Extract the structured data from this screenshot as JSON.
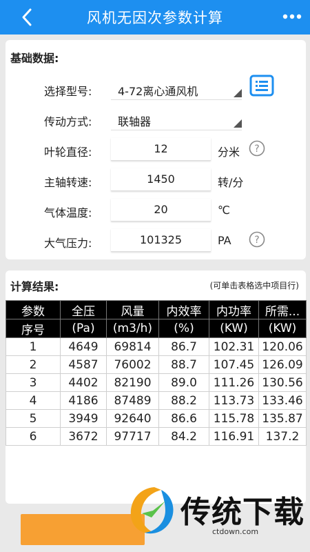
{
  "header": {
    "title": "风机无因次参数计算",
    "back_icon": "chevron-left-icon",
    "more_icon": "more-dots-icon",
    "color": "#1d8ff0"
  },
  "basic": {
    "section_title": "基础数据:",
    "model": {
      "label": "选择型号:",
      "value": "4-72离心通风机"
    },
    "drive": {
      "label": "传动方式:",
      "value": "联轴器"
    },
    "diameter": {
      "label": "叶轮直径:",
      "value": "12",
      "unit": "分米"
    },
    "speed": {
      "label": "主轴转速:",
      "value": "1450",
      "unit": "转/分"
    },
    "temp": {
      "label": "气体温度:",
      "value": "20",
      "unit": "℃"
    },
    "pressure": {
      "label": "大气压力:",
      "value": "101325",
      "unit": "PA"
    }
  },
  "results": {
    "section_title": "计算结果:",
    "hint": "(可单击表格选中项目行)",
    "header_row1": [
      "参数",
      "全压",
      "风量",
      "内效率",
      "内功率",
      "所需..."
    ],
    "header_row2": [
      "序号",
      "(Pa)",
      "(m3/h)",
      "(%)",
      "(KW)",
      "(KW)"
    ],
    "rows": [
      [
        "1",
        "4649",
        "69814",
        "86.7",
        "102.31",
        "120.06"
      ],
      [
        "2",
        "4587",
        "76002",
        "88.7",
        "107.45",
        "126.09"
      ],
      [
        "3",
        "4402",
        "82190",
        "89.0",
        "111.26",
        "130.56"
      ],
      [
        "4",
        "4186",
        "87489",
        "88.2",
        "113.73",
        "133.46"
      ],
      [
        "5",
        "3949",
        "92640",
        "86.6",
        "115.78",
        "135.87"
      ],
      [
        "6",
        "3672",
        "97717",
        "84.2",
        "116.91",
        "137.2"
      ]
    ]
  },
  "watermark": {
    "text": "传统下载",
    "url": "ctdown.com"
  },
  "accent": {
    "button": "#f7a033"
  }
}
